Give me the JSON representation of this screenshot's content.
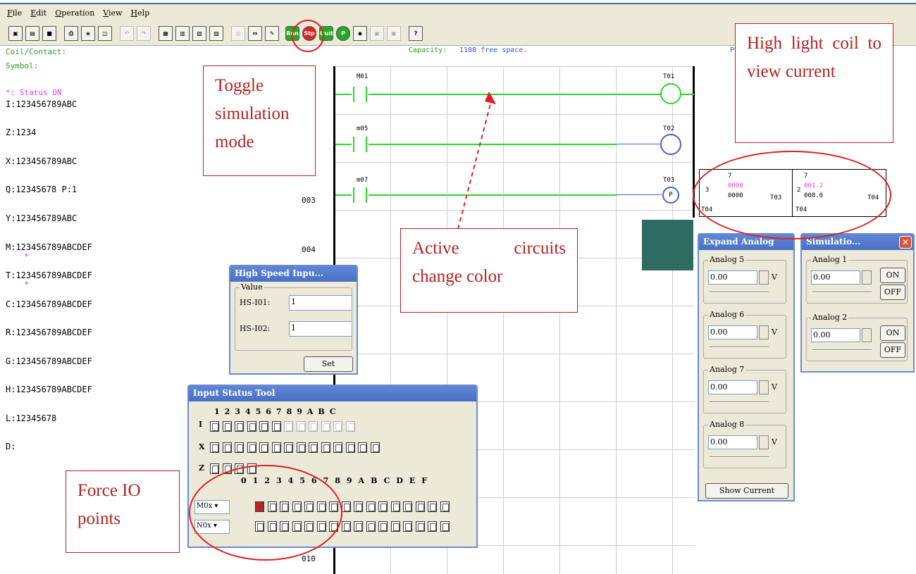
{
  "menu": [
    "File",
    "Edit",
    "Operation",
    "View",
    "Help"
  ],
  "left": {
    "coil_contact": "Coil/Contact:",
    "symbol": "Symbol:",
    "status_on": "*: Status ON",
    "rows": [
      "I:123456789ABC",
      "Z:1234",
      "X:123456789ABC",
      "Q:12345678 P:1",
      "Y:123456789ABC",
      "M:123456789ABCDEF",
      "T:123456789ABCDEF",
      "C:123456789ABCDEF",
      "R:123456789ABCDEF",
      "G:123456789ABCDEF",
      "H:123456789ABCDEF",
      "L:12345678",
      "D:"
    ],
    "star": "*"
  },
  "capacity": {
    "label": "Capacity:",
    "value": "1188 free space."
  },
  "pc_label": "PC",
  "ladder": {
    "row_numbers": [
      "003",
      "004",
      "010"
    ],
    "contacts": [
      "M01",
      "m05",
      "m07"
    ],
    "coils": [
      "T01",
      "T02",
      "T03"
    ],
    "p_label": "P"
  },
  "timer_block": {
    "left_num": "3",
    "top_num": "7",
    "v1": "0000",
    "v2": "0000",
    "ref": "T03",
    "bot": "T04",
    "left_num2": "2",
    "top_num2": "7",
    "v3": "001.2",
    "v4": "008.0",
    "ref2": "T04",
    "bot2": "T04"
  },
  "callouts": {
    "toggle": "Toggle simulation mode",
    "highlight": "High light coil to view current",
    "active": "Active circuits change color",
    "force": "Force IO points"
  },
  "hs_dialog": {
    "title": "High Speed Inpu...",
    "group": "Value",
    "label1": "HS-I01:",
    "val1": "1",
    "label2": "HS-I02:",
    "val2": "1",
    "set": "Set"
  },
  "input_tool": {
    "title": "Input Status Tool",
    "hdr1": "123456789ABC",
    "row_i": "I",
    "row_x": "X",
    "row_z": "Z",
    "hdr2": "0123456789ABCDEF",
    "sel1": "M0x",
    "sel2": "N0x"
  },
  "expand_analog": {
    "title": "Expand Analog",
    "groups": [
      "Analog 5",
      "Analog 6",
      "Analog 7",
      "Analog 8"
    ],
    "value": "0.00",
    "unit": "V",
    "show": "Show Current"
  },
  "simulation": {
    "title": "Simulatio...",
    "groups": [
      "Analog 1",
      "Analog 2"
    ],
    "value": "0.00",
    "on": "ON",
    "off": "OFF",
    "close": "✕"
  },
  "colors": {
    "accent": "#29d629",
    "callout": "#b5211f",
    "title": "#4a6fc5"
  }
}
